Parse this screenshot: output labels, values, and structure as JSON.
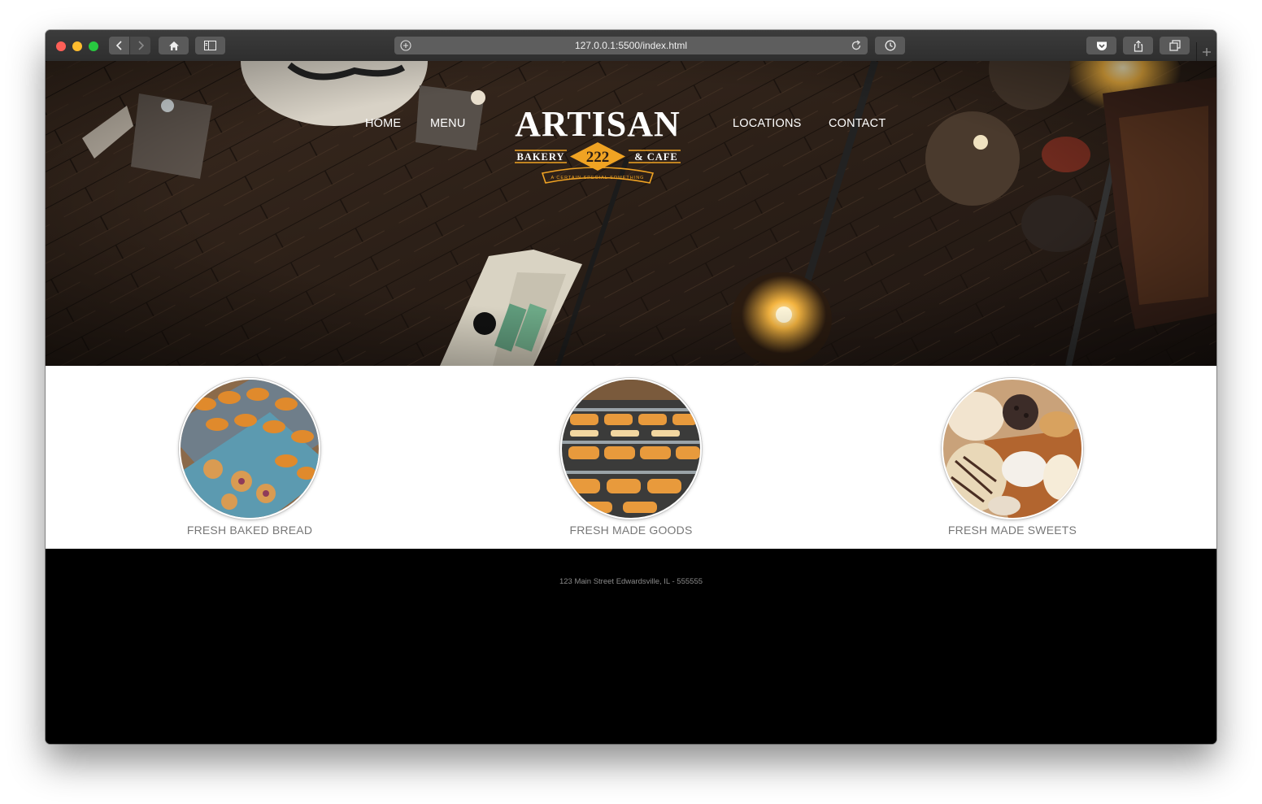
{
  "browser": {
    "url": "127.0.0.1:5500/index.html",
    "icons": [
      "back-icon",
      "forward-icon",
      "home-icon",
      "sidebar-icon",
      "site-icon",
      "reload-icon",
      "history-icon",
      "pocket-icon",
      "share-icon",
      "tabs-icon",
      "new-tab-icon"
    ]
  },
  "nav": {
    "home": "HOME",
    "menu": "MENU",
    "locations": "LOCATIONS",
    "contact": "CONTACT"
  },
  "logo": {
    "name": "ARTISAN",
    "left": "BAKERY",
    "number": "222",
    "right": "& CAFE",
    "tagline": "A CERTAIN SPECIAL SOMETHING",
    "accent": "#f0a323"
  },
  "features": [
    {
      "label": "FRESH BAKED BREAD"
    },
    {
      "label": "FRESH MADE GOODS"
    },
    {
      "label": "FRESH MADE SWEETS"
    }
  ],
  "footer": {
    "address": "123 Main Street Edwardsville, IL - 555555"
  }
}
